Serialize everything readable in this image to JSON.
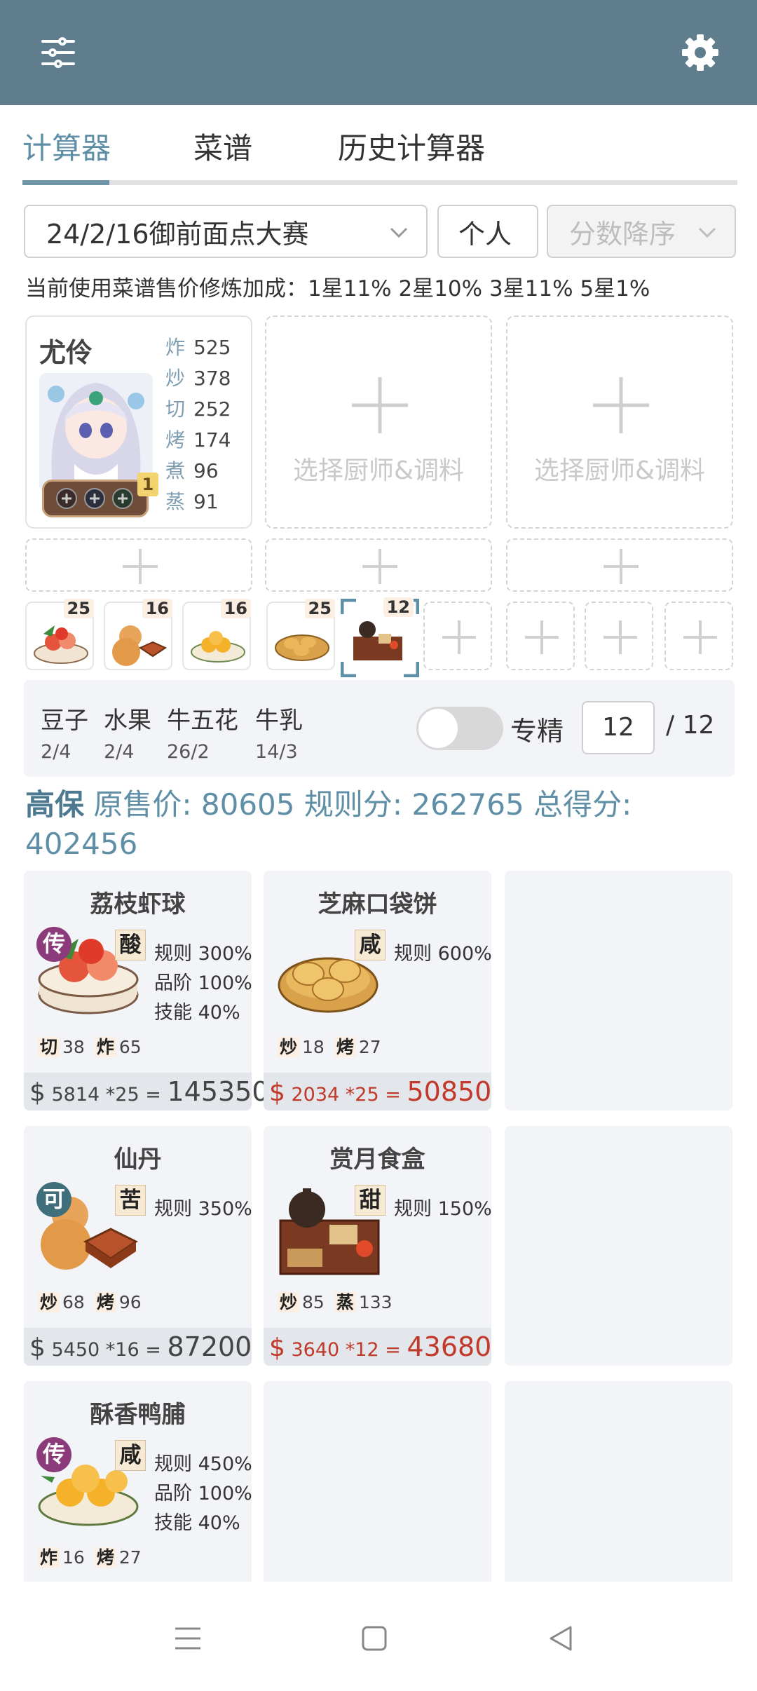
{
  "header": {
    "menu_icon": "sliders-icon",
    "settings_icon": "gear-icon",
    "color": "#5f7d8c"
  },
  "tabs": [
    {
      "label": "计算器",
      "active": true
    },
    {
      "label": "菜谱",
      "active": false
    },
    {
      "label": "历史计算器",
      "active": false
    }
  ],
  "filters": {
    "contest": "24/2/16御前面点大赛",
    "mode": "个人",
    "sort": "分数降序"
  },
  "bonus_text": "当前使用菜谱售价修炼加成：1星11% 2星10% 3星11% 5星1%",
  "chef": {
    "name": "尤伶",
    "level_badge": "1",
    "stats": [
      {
        "k": "炸",
        "v": "525"
      },
      {
        "k": "炒",
        "v": "378"
      },
      {
        "k": "切",
        "v": "252"
      },
      {
        "k": "烤",
        "v": "174"
      },
      {
        "k": "煮",
        "v": "96"
      },
      {
        "k": "蒸",
        "v": "91"
      }
    ]
  },
  "empty_chef_label": "选择厨师&调料",
  "slots": [
    {
      "count": "25",
      "dish": "荔枝虾球"
    },
    {
      "count": "16",
      "dish": "仙丹"
    },
    {
      "count": "16",
      "dish": "酥香鸭脯"
    },
    {
      "count": "25",
      "dish": "芝麻口袋饼"
    },
    {
      "count": "12",
      "dish": "赏月食盒"
    }
  ],
  "materials": [
    {
      "name": "豆子",
      "qty": "2/4"
    },
    {
      "name": "水果",
      "qty": "2/4"
    },
    {
      "name": "牛五花",
      "qty": "26/2"
    },
    {
      "name": "牛乳",
      "qty": "14/3"
    }
  ],
  "mastery": {
    "label": "专精",
    "value": "12",
    "total": "/ 12",
    "on": false
  },
  "summary": {
    "quality": "高保",
    "original_label": "原售价:",
    "original": "80605",
    "rule_label": "规则分:",
    "rule": "262765",
    "total_label": "总得分:",
    "total": "402456"
  },
  "recipes": [
    {
      "title": "荔枝虾球",
      "badge": "传",
      "badge_color": "#8b3a7a",
      "taste": "酸",
      "rules": [
        "规则 300%",
        "品阶 100%",
        "技能 40%"
      ],
      "skills": [
        {
          "k": "切",
          "v": "38"
        },
        {
          "k": "炸",
          "v": "65"
        }
      ],
      "price": "5814 *25",
      "eq": "=",
      "result": "145350",
      "red": false
    },
    {
      "title": "芝麻口袋饼",
      "badge": "",
      "badge_color": "",
      "taste": "咸",
      "rules": [
        "规则 600%"
      ],
      "skills": [
        {
          "k": "炒",
          "v": "18"
        },
        {
          "k": "烤",
          "v": "27"
        }
      ],
      "price": "2034 *25",
      "eq": "=",
      "result": "50850",
      "red": true
    },
    {
      "title": "仙丹",
      "badge": "可",
      "badge_color": "#3f6f7a",
      "taste": "苦",
      "rules": [
        "规则 350%"
      ],
      "skills": [
        {
          "k": "炒",
          "v": "68"
        },
        {
          "k": "烤",
          "v": "96"
        }
      ],
      "price": "5450 *16",
      "eq": "=",
      "result": "87200",
      "red": false
    },
    {
      "title": "赏月食盒",
      "badge": "",
      "badge_color": "",
      "taste": "甜",
      "rules": [
        "规则 150%"
      ],
      "skills": [
        {
          "k": "炒",
          "v": "85"
        },
        {
          "k": "蒸",
          "v": "133"
        }
      ],
      "price": "3640 *12",
      "eq": "=",
      "result": "43680",
      "red": true
    },
    {
      "title": "酥香鸭脯",
      "badge": "传",
      "badge_color": "#8b3a7a",
      "taste": "咸",
      "rules": [
        "规则 450%",
        "品阶 100%",
        "技能 40%"
      ],
      "skills": [
        {
          "k": "炸",
          "v": "16"
        },
        {
          "k": "烤",
          "v": "27"
        }
      ],
      "price": "",
      "eq": "",
      "result": "",
      "red": false
    }
  ],
  "currency_symbol": "$",
  "navbar": [
    "menu-icon",
    "home-square-icon",
    "back-triangle-icon"
  ]
}
